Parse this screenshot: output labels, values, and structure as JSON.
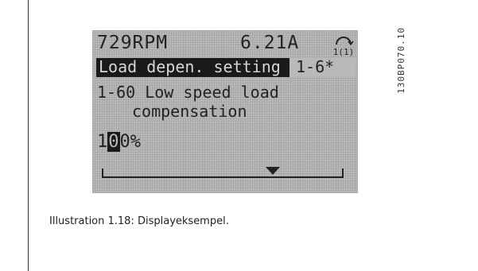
{
  "display": {
    "status_left": "729RPM",
    "status_right": "6.21A",
    "setup_icon_label": "1(1)",
    "menu_title": "Load depen. setting",
    "menu_index": "1-6*",
    "param_line1": "1-60 Low speed load",
    "param_line2": "compensation",
    "value_before_cursor": "1",
    "value_cursor_digit": "0",
    "value_after_cursor": "0%"
  },
  "figure_code": "130BP070.10",
  "caption": "Illustration 1.18: Displayeksempel.",
  "colors": {
    "lcd_background": "#b9b9b9",
    "lcd_text": "#222222",
    "highlight": "#1a1a1a"
  }
}
